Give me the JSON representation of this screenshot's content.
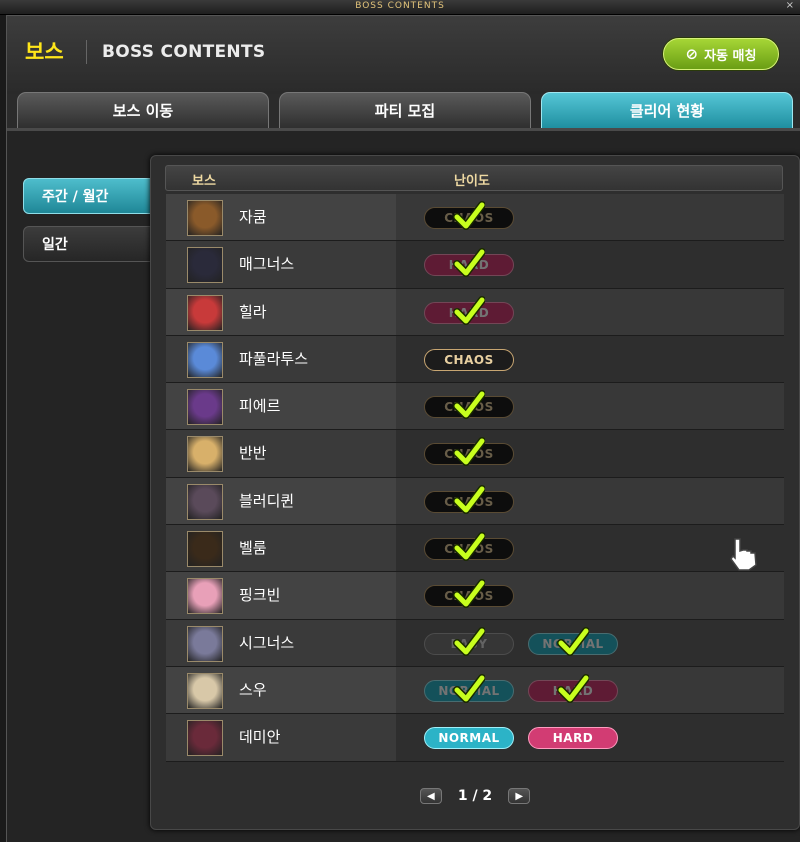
{
  "titlebar": {
    "title": "BOSS CONTENTS",
    "close": "×"
  },
  "header": {
    "title_ko": "보스",
    "title_en": "BOSS CONTENTS",
    "auto_match_label": "자동 매칭",
    "auto_match_icon": "link-icon"
  },
  "tabs": [
    {
      "label": "보스 이동",
      "active": false
    },
    {
      "label": "파티 모집",
      "active": false
    },
    {
      "label": "클리어 현황",
      "active": true
    }
  ],
  "sidebar": [
    {
      "label": "주간 / 월간",
      "active": true
    },
    {
      "label": "일간",
      "active": false
    }
  ],
  "table": {
    "headers": {
      "boss": "보스",
      "difficulty": "난이도"
    },
    "rows": [
      {
        "name": "자쿰",
        "difficulties": [
          {
            "label": "CHAOS",
            "type": "chaos",
            "cleared": true
          }
        ]
      },
      {
        "name": "매그너스",
        "difficulties": [
          {
            "label": "HARD",
            "type": "hard",
            "cleared": true
          }
        ]
      },
      {
        "name": "힐라",
        "difficulties": [
          {
            "label": "HARD",
            "type": "hard",
            "cleared": true
          }
        ]
      },
      {
        "name": "파풀라투스",
        "difficulties": [
          {
            "label": "CHAOS",
            "type": "chaos",
            "cleared": false
          }
        ]
      },
      {
        "name": "피에르",
        "difficulties": [
          {
            "label": "CHAOS",
            "type": "chaos",
            "cleared": true
          }
        ]
      },
      {
        "name": "반반",
        "difficulties": [
          {
            "label": "CHAOS",
            "type": "chaos",
            "cleared": true
          }
        ]
      },
      {
        "name": "블러디퀸",
        "difficulties": [
          {
            "label": "CHAOS",
            "type": "chaos",
            "cleared": true
          }
        ]
      },
      {
        "name": "벨룸",
        "difficulties": [
          {
            "label": "CHAOS",
            "type": "chaos",
            "cleared": true
          }
        ]
      },
      {
        "name": "핑크빈",
        "difficulties": [
          {
            "label": "CHAOS",
            "type": "chaos",
            "cleared": true
          }
        ]
      },
      {
        "name": "시그너스",
        "difficulties": [
          {
            "label": "EASY",
            "type": "easy",
            "cleared": true
          },
          {
            "label": "NORMAL",
            "type": "normal",
            "cleared": true
          }
        ]
      },
      {
        "name": "스우",
        "difficulties": [
          {
            "label": "NORMAL",
            "type": "normal",
            "cleared": true
          },
          {
            "label": "HARD",
            "type": "hard",
            "cleared": true
          }
        ]
      },
      {
        "name": "데미안",
        "difficulties": [
          {
            "label": "NORMAL",
            "type": "normal",
            "cleared": false
          },
          {
            "label": "HARD",
            "type": "hard",
            "cleared": false
          }
        ]
      }
    ]
  },
  "pagination": {
    "text": "1 / 2",
    "prev_icon": "chevron-left-icon",
    "next_icon": "chevron-right-icon"
  },
  "colors": {
    "title_yellow": "#ffe61a",
    "tab_active": "#2aa4b6",
    "auto_match_green": "#8cc326",
    "check_green": "#c8ff1e",
    "hard_pink": "#d23c73",
    "normal_teal": "#2cb3c7",
    "chaos_gold": "#c8a672"
  },
  "portrait_colors": [
    "#8a5a2a",
    "#2a2a3a",
    "#c83a3a",
    "#5a8ad8",
    "#6a3a8a",
    "#d8b06a",
    "#5a4a5a",
    "#3a2a1a",
    "#e8a0b8",
    "#7a7a9a",
    "#d8c8a8",
    "#6a2a3a"
  ]
}
